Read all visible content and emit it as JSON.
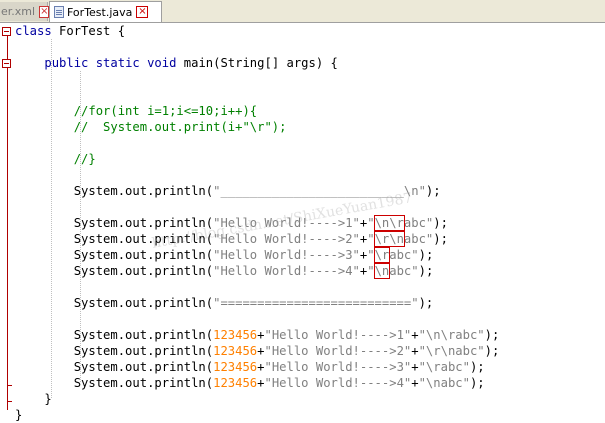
{
  "tabs": [
    {
      "label": "er.xml",
      "active": false
    },
    {
      "label": "ForTest.java",
      "active": true
    }
  ],
  "code_lines": [
    {
      "segments": [
        {
          "t": "class",
          "c": "kw"
        },
        {
          "t": " ForTest {",
          "c": ""
        }
      ]
    },
    {
      "segments": []
    },
    {
      "segments": [
        {
          "t": "    ",
          "c": ""
        },
        {
          "t": "public static void",
          "c": "kw"
        },
        {
          "t": " main(String[] args) {",
          "c": ""
        }
      ]
    },
    {
      "segments": []
    },
    {
      "segments": []
    },
    {
      "segments": [
        {
          "t": "        //for(int i=1;i<=10;i++){",
          "c": "cm"
        }
      ]
    },
    {
      "segments": [
        {
          "t": "        //  System.out.print(i+\"\\r\");",
          "c": "cm"
        }
      ]
    },
    {
      "segments": []
    },
    {
      "segments": [
        {
          "t": "        //}",
          "c": "cm"
        }
      ]
    },
    {
      "segments": []
    },
    {
      "segments": [
        {
          "t": "        System.out.println(",
          "c": ""
        },
        {
          "t": "\"_________________________\\n\"",
          "c": "str"
        },
        {
          "t": ");",
          "c": ""
        }
      ]
    },
    {
      "segments": []
    },
    {
      "segments": [
        {
          "t": "        System.out.println(",
          "c": ""
        },
        {
          "t": "\"Hello World!---->1\"",
          "c": "str"
        },
        {
          "t": "+",
          "c": ""
        },
        {
          "t": "\"",
          "c": "str"
        },
        {
          "t": "\\n\\r",
          "c": "str hl"
        },
        {
          "t": "abc\"",
          "c": "str"
        },
        {
          "t": ");",
          "c": ""
        }
      ]
    },
    {
      "segments": [
        {
          "t": "        System.out.println(",
          "c": ""
        },
        {
          "t": "\"Hello World!---->2\"",
          "c": "str"
        },
        {
          "t": "+",
          "c": ""
        },
        {
          "t": "\"",
          "c": "str"
        },
        {
          "t": "\\r\\n",
          "c": "str hl"
        },
        {
          "t": "abc\"",
          "c": "str"
        },
        {
          "t": ");",
          "c": ""
        }
      ]
    },
    {
      "segments": [
        {
          "t": "        System.out.println(",
          "c": ""
        },
        {
          "t": "\"Hello World!---->3\"",
          "c": "str"
        },
        {
          "t": "+",
          "c": ""
        },
        {
          "t": "\"",
          "c": "str"
        },
        {
          "t": "\\r",
          "c": "str hl"
        },
        {
          "t": "abc\"",
          "c": "str"
        },
        {
          "t": ");",
          "c": ""
        }
      ]
    },
    {
      "segments": [
        {
          "t": "        System.out.println(",
          "c": ""
        },
        {
          "t": "\"Hello World!---->4\"",
          "c": "str"
        },
        {
          "t": "+",
          "c": ""
        },
        {
          "t": "\"",
          "c": "str"
        },
        {
          "t": "\\n",
          "c": "str hl"
        },
        {
          "t": "abc\"",
          "c": "str"
        },
        {
          "t": ");",
          "c": ""
        }
      ]
    },
    {
      "segments": []
    },
    {
      "segments": [
        {
          "t": "        System.out.println(",
          "c": ""
        },
        {
          "t": "\"==========================\"",
          "c": "str"
        },
        {
          "t": ");",
          "c": ""
        }
      ]
    },
    {
      "segments": []
    },
    {
      "segments": [
        {
          "t": "        System.out.println(",
          "c": ""
        },
        {
          "t": "123456",
          "c": "num"
        },
        {
          "t": "+",
          "c": ""
        },
        {
          "t": "\"Hello World!---->1\"",
          "c": "str"
        },
        {
          "t": "+",
          "c": ""
        },
        {
          "t": "\"\\n\\rabc\"",
          "c": "str"
        },
        {
          "t": ");",
          "c": ""
        }
      ]
    },
    {
      "segments": [
        {
          "t": "        System.out.println(",
          "c": ""
        },
        {
          "t": "123456",
          "c": "num"
        },
        {
          "t": "+",
          "c": ""
        },
        {
          "t": "\"Hello World!---->2\"",
          "c": "str"
        },
        {
          "t": "+",
          "c": ""
        },
        {
          "t": "\"\\r\\nabc\"",
          "c": "str"
        },
        {
          "t": ");",
          "c": ""
        }
      ]
    },
    {
      "segments": [
        {
          "t": "        System.out.println(",
          "c": ""
        },
        {
          "t": "123456",
          "c": "num"
        },
        {
          "t": "+",
          "c": ""
        },
        {
          "t": "\"Hello World!---->3\"",
          "c": "str"
        },
        {
          "t": "+",
          "c": ""
        },
        {
          "t": "\"\\rabc\"",
          "c": "str"
        },
        {
          "t": ");",
          "c": ""
        }
      ]
    },
    {
      "segments": [
        {
          "t": "        System.out.println(",
          "c": ""
        },
        {
          "t": "123456",
          "c": "num"
        },
        {
          "t": "+",
          "c": ""
        },
        {
          "t": "\"Hello World!---->4\"",
          "c": "str"
        },
        {
          "t": "+",
          "c": ""
        },
        {
          "t": "\"\\nabc\"",
          "c": "str"
        },
        {
          "t": ");",
          "c": ""
        }
      ]
    },
    {
      "segments": [
        {
          "t": "    }",
          "c": ""
        }
      ]
    },
    {
      "segments": [
        {
          "t": "}",
          "c": ""
        }
      ]
    }
  ],
  "watermark": "http://blog.csdn.net/ShiXueYuan1987",
  "colors": {
    "keyword": "#0000a0",
    "string": "#808080",
    "number": "#ff8000",
    "comment": "#008000",
    "fold": "#b00000",
    "highlight": "#cc0000"
  }
}
